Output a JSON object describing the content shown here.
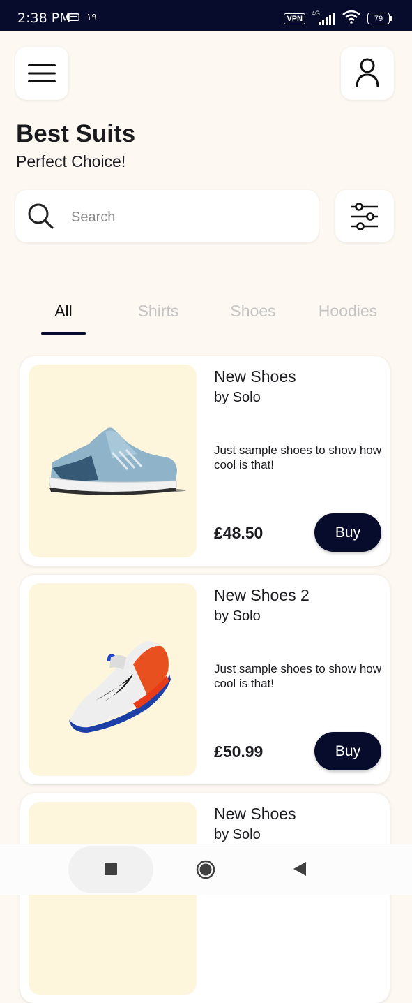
{
  "status_bar": {
    "time": "2:38 PM",
    "extra": "١٩",
    "vpn": "VPN",
    "network": "4G",
    "battery": "79"
  },
  "header": {
    "menu_icon": "hamburger-menu-icon",
    "profile_icon": "user-profile-icon",
    "title": "Best Suits",
    "subtitle": "Perfect Choice!"
  },
  "search": {
    "placeholder": "Search",
    "value": "",
    "icon": "search-icon",
    "filter_icon": "filter-sliders-icon"
  },
  "tabs": [
    {
      "label": "All",
      "active": true
    },
    {
      "label": "Shirts",
      "active": false
    },
    {
      "label": "Shoes",
      "active": false
    },
    {
      "label": "Hoodies",
      "active": false
    }
  ],
  "products": [
    {
      "name": "New Shoes",
      "by": "by Solo",
      "description": "Just sample shoes to show how cool is that!",
      "price": "£48.50",
      "buy_label": "Buy"
    },
    {
      "name": "New Shoes 2",
      "by": "by Solo",
      "description": "Just sample shoes to show how cool is that!",
      "price": "£50.99",
      "buy_label": "Buy"
    },
    {
      "name": "New Shoes",
      "by": "by Solo",
      "description": "",
      "price": "",
      "buy_label": ""
    }
  ],
  "nav_bar": {
    "recent_icon": "square-recent-apps-icon",
    "home_icon": "circle-home-icon",
    "back_icon": "triangle-back-icon"
  },
  "colors": {
    "primary": "#070b2c",
    "background": "#fdf8f2",
    "image_background": "#fdf6dd",
    "inactive_tab": "#c4c4c4"
  }
}
